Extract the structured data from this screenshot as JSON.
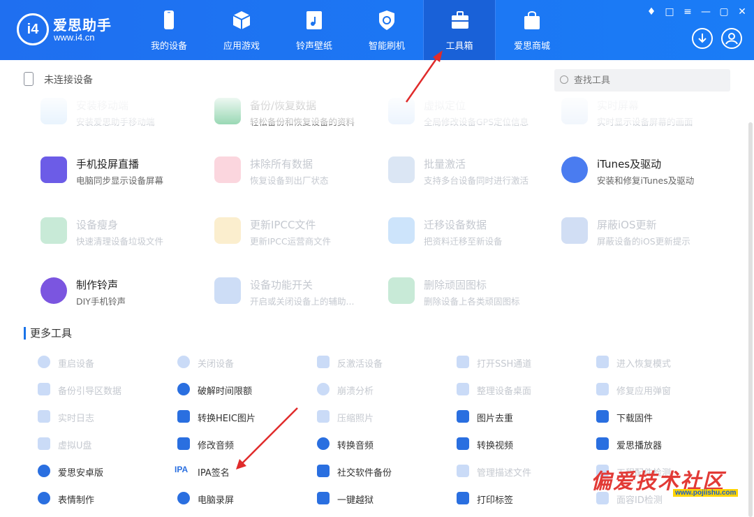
{
  "brand": {
    "name": "爱思助手",
    "url": "www.i4.cn",
    "logo_text": "i4"
  },
  "nav": [
    {
      "label": "我的设备",
      "icon": "phone-icon"
    },
    {
      "label": "应用游戏",
      "icon": "cube-icon"
    },
    {
      "label": "铃声壁纸",
      "icon": "music-folder-icon"
    },
    {
      "label": "智能刷机",
      "icon": "refresh-shield-icon"
    },
    {
      "label": "工具箱",
      "icon": "toolbox-icon",
      "active": true
    },
    {
      "label": "爱思商城",
      "icon": "shopping-bag-icon"
    }
  ],
  "toolbar": {
    "device_status": "未连接设备",
    "search_placeholder": "查找工具"
  },
  "tools": [
    {
      "name": "安装移动端",
      "desc": "安装爱思助手移动端",
      "icon": "i4-mobile-icon",
      "enabled": false
    },
    {
      "name": "备份/恢复数据",
      "desc": "轻松备份和恢复设备的资料",
      "icon": "layers-icon",
      "enabled": true
    },
    {
      "name": "虚拟定位",
      "desc": "全局修改设备GPS定位信息",
      "icon": "location-icon",
      "enabled": false
    },
    {
      "name": "实时屏幕",
      "desc": "实时显示设备屏幕的画面",
      "icon": "screen-icon",
      "enabled": false
    },
    {
      "name": "手机投屏直播",
      "desc": "电脑同步显示设备屏幕",
      "icon": "cast-icon",
      "enabled": true
    },
    {
      "name": "抹除所有数据",
      "desc": "恢复设备到出厂状态",
      "icon": "eraser-icon",
      "enabled": false
    },
    {
      "name": "批量激活",
      "desc": "支持多台设备同时进行激活",
      "icon": "batch-activate-icon",
      "enabled": false
    },
    {
      "name": "iTunes及驱动",
      "desc": "安装和修复iTunes及驱动",
      "icon": "itunes-icon",
      "enabled": true
    },
    {
      "name": "设备瘦身",
      "desc": "快速清理设备垃圾文件",
      "icon": "broom-icon",
      "enabled": false
    },
    {
      "name": "更新IPCC文件",
      "desc": "更新IPCC运营商文件",
      "icon": "ipcc-icon",
      "enabled": false
    },
    {
      "name": "迁移设备数据",
      "desc": "把资料迁移至新设备",
      "icon": "migrate-icon",
      "enabled": false
    },
    {
      "name": "屏蔽iOS更新",
      "desc": "屏蔽设备的iOS更新提示",
      "icon": "block-update-icon",
      "enabled": false
    },
    {
      "name": "制作铃声",
      "desc": "DIY手机铃声",
      "icon": "ringtone-icon",
      "enabled": true
    },
    {
      "name": "设备功能开关",
      "desc": "开启或关闭设备上的辅助...",
      "icon": "switches-icon",
      "enabled": false
    },
    {
      "name": "删除顽固图标",
      "desc": "删除设备上各类顽固图标",
      "icon": "trash-icon",
      "enabled": false
    }
  ],
  "more_tools_title": "更多工具",
  "more_tools": [
    {
      "label": "重启设备",
      "icon": "restart-icon",
      "enabled": false
    },
    {
      "label": "关闭设备",
      "icon": "power-icon",
      "enabled": false
    },
    {
      "label": "反激活设备",
      "icon": "deactivate-icon",
      "enabled": false
    },
    {
      "label": "打开SSH通道",
      "icon": "ssh-icon",
      "enabled": false
    },
    {
      "label": "进入恢复模式",
      "icon": "recovery-icon",
      "enabled": false
    },
    {
      "label": "备份引导区数据",
      "icon": "backup-boot-icon",
      "enabled": false
    },
    {
      "label": "破解时间限额",
      "icon": "clock-icon",
      "enabled": true
    },
    {
      "label": "崩溃分析",
      "icon": "crash-icon",
      "enabled": false
    },
    {
      "label": "整理设备桌面",
      "icon": "grid-icon",
      "enabled": false
    },
    {
      "label": "修复应用弹窗",
      "icon": "repair-icon",
      "enabled": false
    },
    {
      "label": "实时日志",
      "icon": "log-icon",
      "enabled": false
    },
    {
      "label": "转换HEIC图片",
      "icon": "heic-icon",
      "enabled": true
    },
    {
      "label": "压缩照片",
      "icon": "compress-icon",
      "enabled": false
    },
    {
      "label": "图片去重",
      "icon": "dedupe-icon",
      "enabled": true
    },
    {
      "label": "下载固件",
      "icon": "download-firmware-icon",
      "enabled": true
    },
    {
      "label": "虚拟U盘",
      "icon": "usb-icon",
      "enabled": false
    },
    {
      "label": "修改音频",
      "icon": "audio-edit-icon",
      "enabled": true
    },
    {
      "label": "转换音频",
      "icon": "audio-convert-icon",
      "enabled": true
    },
    {
      "label": "转换视频",
      "icon": "video-convert-icon",
      "enabled": true
    },
    {
      "label": "爱思播放器",
      "icon": "player-icon",
      "enabled": true
    },
    {
      "label": "爱思安卓版",
      "icon": "i4-android-icon",
      "enabled": true
    },
    {
      "label": "IPA签名",
      "icon": "ipa-icon",
      "icon_text": "IPA",
      "enabled": true
    },
    {
      "label": "社交软件备份",
      "icon": "social-backup-icon",
      "enabled": true
    },
    {
      "label": "管理描述文件",
      "icon": "profile-icon",
      "enabled": false
    },
    {
      "label": "工程配件检测",
      "icon": "accessory-icon",
      "enabled": false
    },
    {
      "label": "表情制作",
      "icon": "emoji-icon",
      "enabled": true
    },
    {
      "label": "电脑录屏",
      "icon": "record-icon",
      "enabled": true
    },
    {
      "label": "一键越狱",
      "icon": "unlock-icon",
      "enabled": true
    },
    {
      "label": "打印标签",
      "icon": "printer-icon",
      "enabled": true
    },
    {
      "label": "面容ID检测",
      "icon": "faceid-icon",
      "enabled": false
    }
  ],
  "watermark": {
    "text": "偏爱技术社区",
    "url": "www.pojiishu.com"
  },
  "colors": {
    "header": "#1a73ef",
    "accent": "#1a73e8",
    "dim_text": "#c5c9d0",
    "arrow": "#e02b2b"
  }
}
